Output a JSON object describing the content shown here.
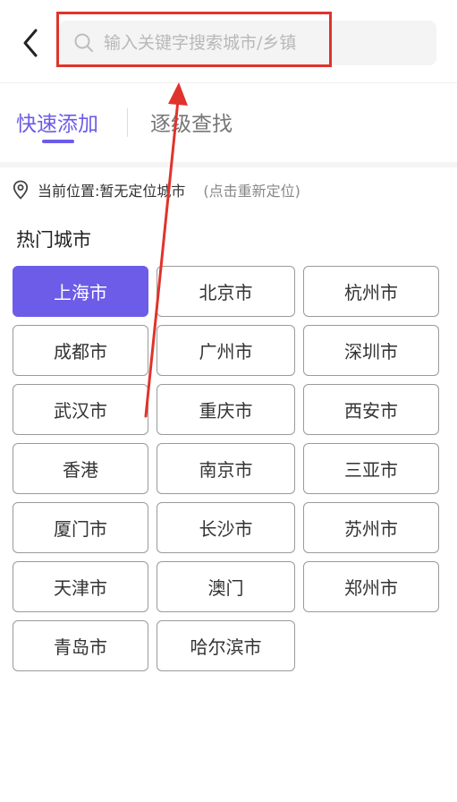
{
  "search": {
    "placeholder": "输入关键字搜索城市/乡镇",
    "value": ""
  },
  "tabs": [
    {
      "label": "快速添加",
      "active": true
    },
    {
      "label": "逐级查找",
      "active": false
    }
  ],
  "location": {
    "label": "当前位置:",
    "value": "暂无定位城市",
    "relocate": "(点击重新定位)"
  },
  "hot_cities": {
    "title": "热门城市",
    "items": [
      {
        "name": "上海市",
        "selected": true
      },
      {
        "name": "北京市",
        "selected": false
      },
      {
        "name": "杭州市",
        "selected": false
      },
      {
        "name": "成都市",
        "selected": false
      },
      {
        "name": "广州市",
        "selected": false
      },
      {
        "name": "深圳市",
        "selected": false
      },
      {
        "name": "武汉市",
        "selected": false
      },
      {
        "name": "重庆市",
        "selected": false
      },
      {
        "name": "西安市",
        "selected": false
      },
      {
        "name": "香港",
        "selected": false
      },
      {
        "name": "南京市",
        "selected": false
      },
      {
        "name": "三亚市",
        "selected": false
      },
      {
        "name": "厦门市",
        "selected": false
      },
      {
        "name": "长沙市",
        "selected": false
      },
      {
        "name": "苏州市",
        "selected": false
      },
      {
        "name": "天津市",
        "selected": false
      },
      {
        "name": "澳门",
        "selected": false
      },
      {
        "name": "郑州市",
        "selected": false
      },
      {
        "name": "青岛市",
        "selected": false
      },
      {
        "name": "哈尔滨市",
        "selected": false
      }
    ]
  },
  "colors": {
    "accent": "#6c5ce7",
    "annotation": "#e0332c"
  },
  "icons": {
    "back": "chevron-left-icon",
    "search": "search-icon",
    "location": "location-pin-icon"
  }
}
